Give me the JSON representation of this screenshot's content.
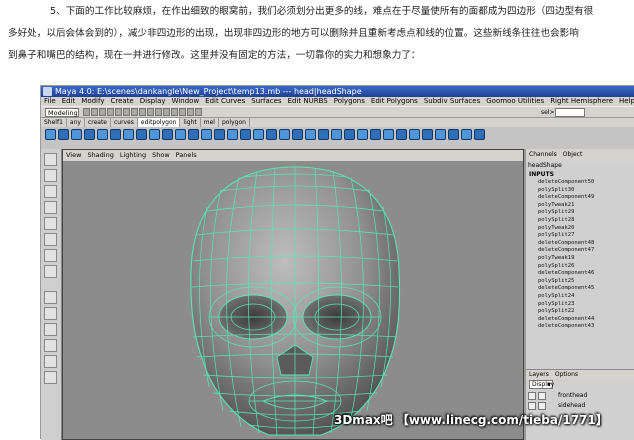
{
  "article": {
    "line1": "5、下面的工作比较麻烦，在作出细致的眼窝前，我们必须划分出更多的线，难点在于尽量使所有的面都成为四边形（四边型有很",
    "line2": "多好处，以后会体会到的），减少非四边形的出现，出现非四边形的地方可以删除并且重新考虑点和线的位置。这些新线条往往也会影响",
    "line3": "到鼻子和嘴巴的结构，现在一并进行修改。这里并没有固定的方法，一切靠你的实力和想象力了："
  },
  "window": {
    "title": "Maya 4.0: E:\\scenes\\dankangle\\New_Project\\temp13.mb   ---   head|headShape"
  },
  "menubar": [
    "File",
    "Edit",
    "Modify",
    "Create",
    "Display",
    "Window",
    "Edit Curves",
    "Surfaces",
    "Edit NURBS",
    "Polygons",
    "Edit Polygons",
    "Subdiv Surfaces",
    "Goomoo Utilities",
    "Right Hemisphere",
    "Help"
  ],
  "statusline": {
    "mode": "Modeling",
    "sel_label": "sel>"
  },
  "shelf_tabs": [
    "Shelf1",
    "any",
    "create",
    "curves",
    "editpolygon",
    "light",
    "mel",
    "polygon"
  ],
  "shelf_active_tab": "editpolygon",
  "panel_menu": [
    "View",
    "Shading",
    "Lighting",
    "Show",
    "Panels"
  ],
  "channel_box": {
    "tabs": [
      "Channels",
      "Object"
    ],
    "node": "headShape",
    "inputs_label": "INPUTS",
    "history": [
      "deleteComponent50",
      "polySplit30",
      "deleteComponent49",
      "polyTweak21",
      "polySplit29",
      "polySplit28",
      "polyTweak20",
      "polySplit27",
      "deleteComponent48",
      "deleteComponent47",
      "polyTweak19",
      "polySplit26",
      "deleteComponent46",
      "polySplit25",
      "deleteComponent45",
      "polySplit24",
      "polySplit23",
      "polySplit22",
      "deleteComponent44",
      "deleteComponent43"
    ]
  },
  "layers": {
    "tabs": [
      "Layers",
      "Options"
    ],
    "dropdown": "Display",
    "rows": [
      "fronthead",
      "sidehead"
    ]
  },
  "watermark": "3Dmax吧 【www.linecg.com/tieba/1771】",
  "colors": {
    "viewport_bg": "#8c8c8c",
    "wire_green": "#59e6b4",
    "mesh_light": "#bcbcbc",
    "mesh_dark": "#4a4a4a",
    "shelf_icon": "#2e6fb8"
  }
}
